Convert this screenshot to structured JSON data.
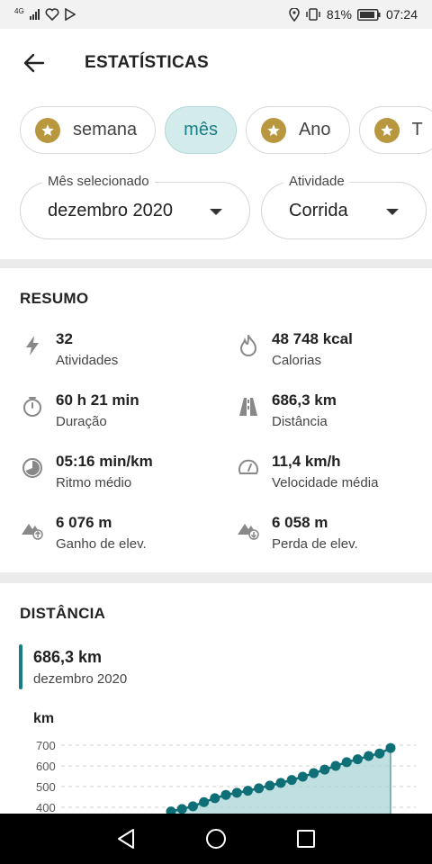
{
  "status_bar": {
    "network": "4G",
    "battery": "81%",
    "time": "07:24"
  },
  "header": {
    "title": "ESTATÍSTICAS"
  },
  "periods": [
    {
      "label": "semana",
      "premium": true,
      "active": false
    },
    {
      "label": "mês",
      "premium": false,
      "active": true
    },
    {
      "label": "Ano",
      "premium": true,
      "active": false
    },
    {
      "label": "T",
      "premium": true,
      "active": false
    }
  ],
  "month_select": {
    "label": "Mês selecionado",
    "value": "dezembro 2020"
  },
  "activity_select": {
    "label": "Atividade",
    "value": "Corrida"
  },
  "resumo": {
    "title": "RESUMO",
    "stats": [
      {
        "value": "32",
        "caption": "Atividades",
        "icon": "bolt-icon"
      },
      {
        "value": "48 748 kcal",
        "caption": "Calorias",
        "icon": "flame-icon"
      },
      {
        "value": "60 h 21 min",
        "caption": "Duração",
        "icon": "stopwatch-icon"
      },
      {
        "value": "686,3 km",
        "caption": "Distância",
        "icon": "road-icon"
      },
      {
        "value": "05:16 min/km",
        "caption": "Ritmo médio",
        "icon": "pace-icon"
      },
      {
        "value": "11,4 km/h",
        "caption": "Velocidade média",
        "icon": "speedometer-icon"
      },
      {
        "value": "6 076 m",
        "caption": "Ganho de elev.",
        "icon": "elevation-gain-icon"
      },
      {
        "value": "6 058 m",
        "caption": "Perda de elev.",
        "icon": "elevation-loss-icon"
      }
    ]
  },
  "distancia": {
    "title": "DISTÂNCIA",
    "total": "686,3 km",
    "period": "dezembro 2020"
  },
  "chart_data": {
    "type": "area",
    "ylabel": "km",
    "yticks": [
      400,
      500,
      600,
      700
    ],
    "ylim": [
      350,
      760
    ],
    "x": [
      11,
      12,
      13,
      14,
      15,
      16,
      17,
      18,
      19,
      20,
      21,
      22,
      23,
      24,
      25,
      26,
      27,
      28,
      29,
      30,
      31
    ],
    "values": [
      380,
      392,
      405,
      425,
      444,
      460,
      470,
      480,
      492,
      505,
      518,
      532,
      548,
      565,
      582,
      600,
      618,
      632,
      648,
      660,
      686.3
    ],
    "xlim": [
      1,
      31
    ],
    "grid": true,
    "colors": {
      "line": "#0e6f77",
      "point": "#0e6f77",
      "fill": "#a9d4d6"
    }
  },
  "colors": {
    "accent": "#177e85",
    "premium_star": "#b8973f",
    "chip_active_bg": "#d4ebec"
  }
}
